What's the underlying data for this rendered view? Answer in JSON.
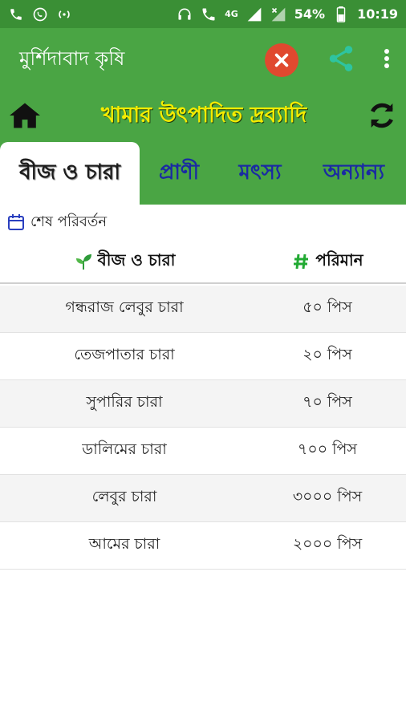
{
  "status_bar": {
    "battery": "54%",
    "time": "10:19",
    "network": "4G"
  },
  "app_bar": {
    "title": "মুর্শিদাবাদ কৃষি"
  },
  "header": {
    "title": "খামার উৎপাদিত দ্রব্যাদি"
  },
  "tabs": [
    {
      "label": "বীজ ও চারা",
      "active": true
    },
    {
      "label": "প্রাণী",
      "active": false
    },
    {
      "label": "মৎস্য",
      "active": false
    },
    {
      "label": "অন্যান্য",
      "active": false
    }
  ],
  "last_updated": {
    "label": "শেষ পরিবর্তন"
  },
  "table": {
    "columns": [
      "বীজ ও চারা",
      "পরিমান"
    ],
    "rows": [
      {
        "item": "গন্ধরাজ লেবুর চারা",
        "qty": "৫০ পিস"
      },
      {
        "item": "তেজপাতার চারা",
        "qty": "২০ পিস"
      },
      {
        "item": "সুপারির চারা",
        "qty": "৭০ পিস"
      },
      {
        "item": "ডালিমের চারা",
        "qty": "৭০০ পিস"
      },
      {
        "item": "লেবুর চারা",
        "qty": "৩০০০ পিস"
      },
      {
        "item": "আমের চারা",
        "qty": "২০০০ পিস"
      }
    ]
  },
  "colors": {
    "primary": "#4aa544",
    "status": "#3a8f35",
    "header_text": "#f5ec00",
    "tab_text": "#1a2aa3",
    "close": "#e0492f",
    "share": "#2ec4a0"
  }
}
